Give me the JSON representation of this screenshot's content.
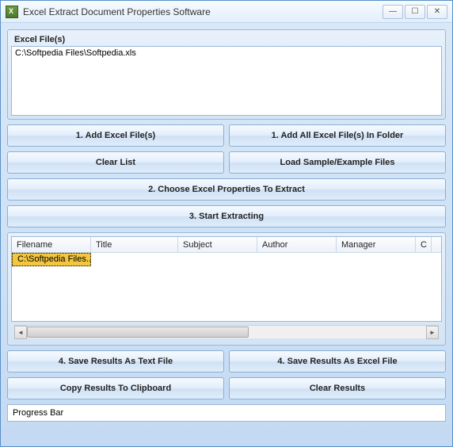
{
  "window": {
    "title": "Excel Extract Document Properties Software"
  },
  "files": {
    "label": "Excel File(s)",
    "items": [
      "C:\\Softpedia Files\\Softpedia.xls"
    ]
  },
  "buttons": {
    "add_files": "1. Add Excel File(s)",
    "add_folder": "1. Add All Excel File(s) In Folder",
    "clear_list": "Clear List",
    "load_sample": "Load Sample/Example Files",
    "choose_props": "2. Choose Excel Properties To Extract",
    "start": "3. Start Extracting",
    "save_text": "4. Save Results As Text File",
    "save_excel": "4. Save Results As Excel File",
    "copy_clip": "Copy Results To Clipboard",
    "clear_results": "Clear Results"
  },
  "grid": {
    "columns": [
      "Filename",
      "Title",
      "Subject",
      "Author",
      "Manager",
      "C"
    ],
    "rows": [
      {
        "filename": "C:\\Softpedia Files...",
        "title": "",
        "subject": "",
        "author": "",
        "manager": ""
      }
    ]
  },
  "progress": {
    "label": "Progress Bar"
  }
}
